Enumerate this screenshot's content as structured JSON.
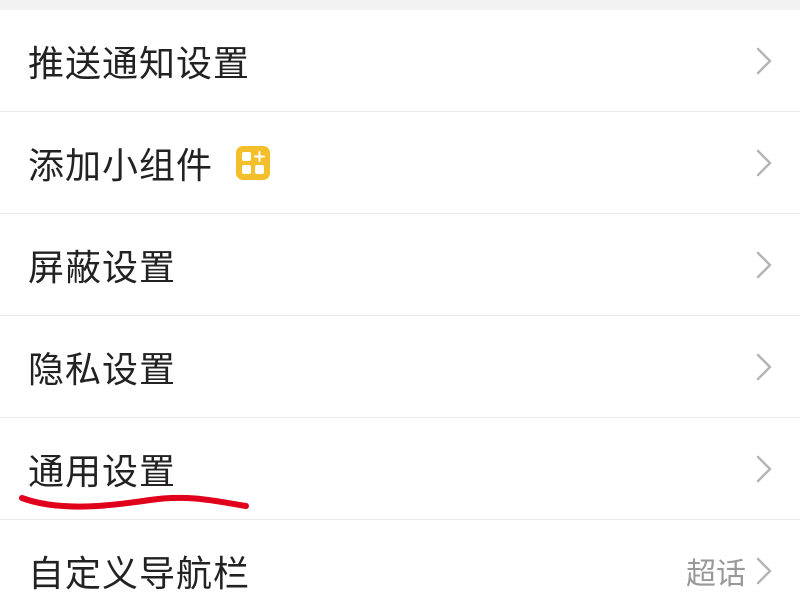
{
  "settings": {
    "items": [
      {
        "label": "推送通知设置",
        "value": ""
      },
      {
        "label": "添加小组件",
        "value": "",
        "icon": "widget-grid-icon"
      },
      {
        "label": "屏蔽设置",
        "value": ""
      },
      {
        "label": "隐私设置",
        "value": ""
      },
      {
        "label": "通用设置",
        "value": "",
        "highlighted": true
      },
      {
        "label": "自定义导航栏",
        "value": "超话"
      }
    ]
  },
  "colors": {
    "accent_yellow": "#f3c02c",
    "annotation_red": "#e0001b",
    "text_primary": "#222222",
    "text_secondary": "#999999",
    "divider": "#ececec"
  }
}
